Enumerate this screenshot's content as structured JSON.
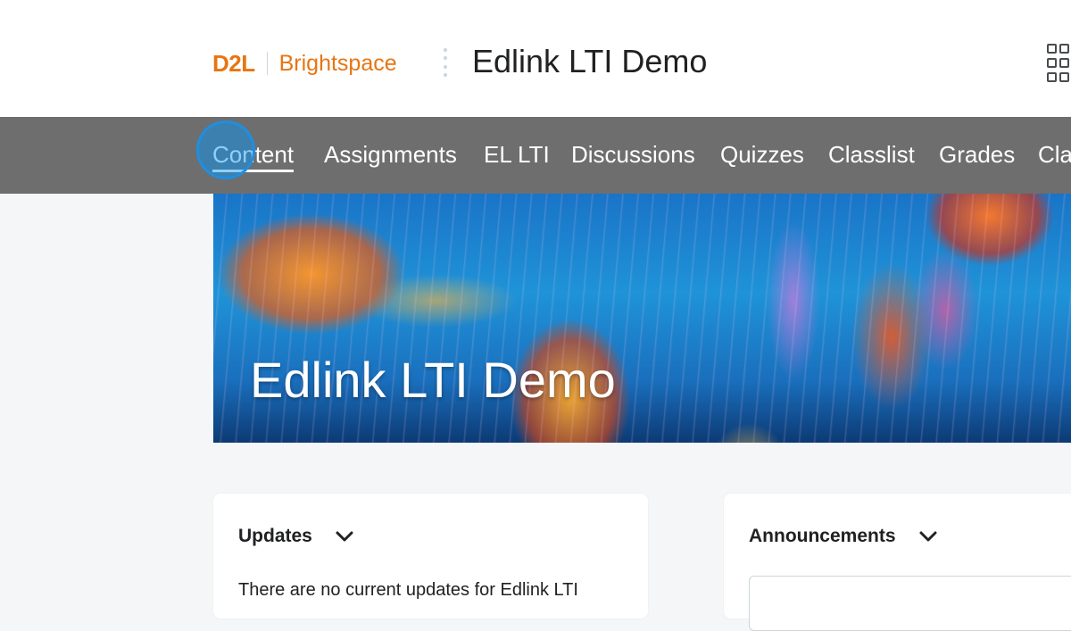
{
  "header": {
    "logo": {
      "brand": "D2L",
      "product": "Brightspace"
    },
    "course_title": "Edlink LTI Demo",
    "icons": {
      "apps": "waffle-grid-icon"
    }
  },
  "nav": {
    "items": [
      {
        "label": "Content",
        "active": true
      },
      {
        "label": "Assignments"
      },
      {
        "label": "EL LTI"
      },
      {
        "label": "Discussions"
      },
      {
        "label": "Quizzes"
      },
      {
        "label": "Classlist"
      },
      {
        "label": "Grades"
      },
      {
        "label": "Cla"
      }
    ]
  },
  "banner": {
    "title": "Edlink LTI Demo",
    "image": "jellyfish-banner-image"
  },
  "widgets": {
    "updates": {
      "title": "Updates",
      "message": "There are no current updates for Edlink LTI"
    },
    "announcements": {
      "title": "Announcements"
    }
  },
  "colors": {
    "brand_orange": "#e87511",
    "navbar": "#6e6e6e",
    "page_bg": "#f4f6f8",
    "click_indicator": "#1f8fe0"
  }
}
